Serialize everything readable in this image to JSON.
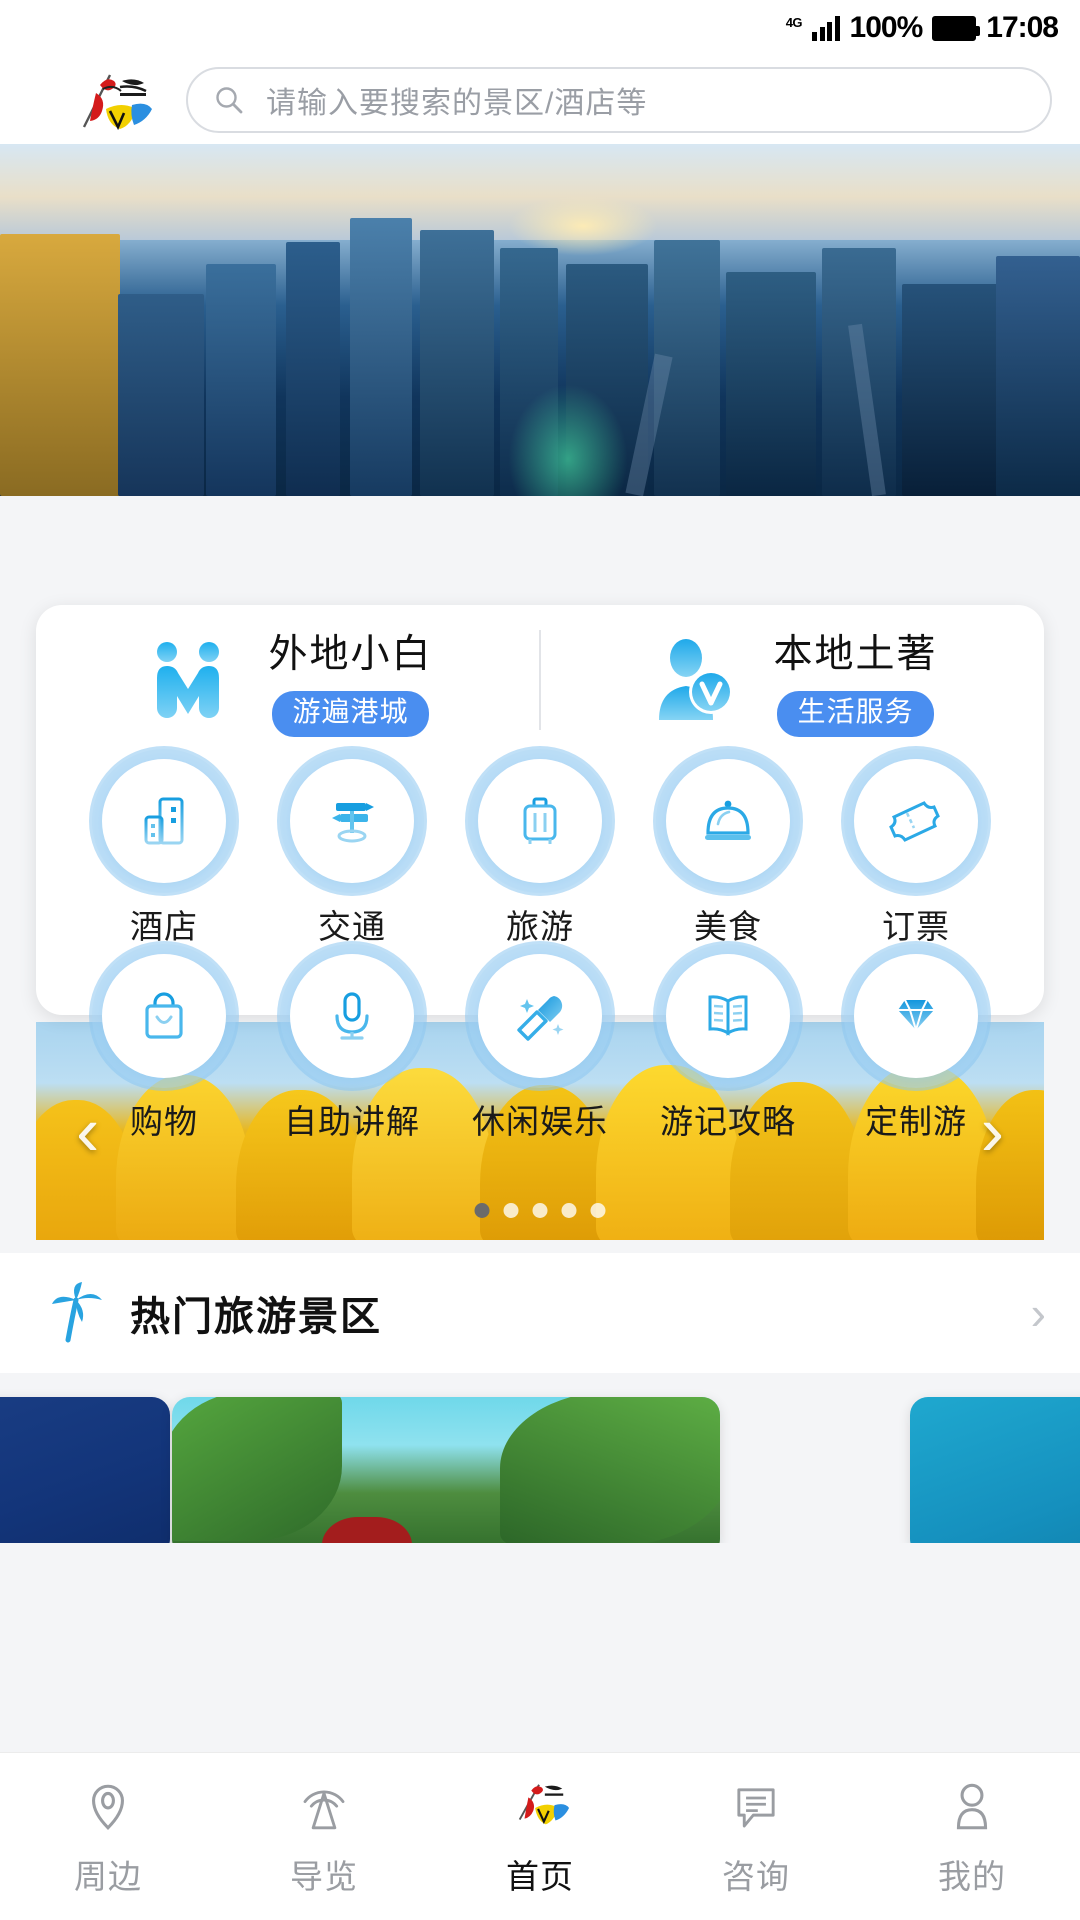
{
  "status_bar": {
    "network": "4G",
    "battery_percent": "100%",
    "time": "17:08"
  },
  "header": {
    "logo_name": "app-logo",
    "search": {
      "placeholder": "请输入要搜索的景区/酒店等",
      "value": "",
      "icon": "search-icon"
    }
  },
  "hero": {
    "alt": "aerial-city-view-banner"
  },
  "user_types": [
    {
      "id": "visitor",
      "icon": "two-people-icon",
      "title": "外地小白",
      "badge": "游遍港城"
    },
    {
      "id": "local",
      "icon": "person-vip-icon",
      "title": "本地土著",
      "badge": "生活服务"
    }
  ],
  "quick_grid": [
    {
      "icon": "hotel-building-icon",
      "label": "酒店"
    },
    {
      "icon": "signpost-icon",
      "label": "交通"
    },
    {
      "icon": "suitcase-icon",
      "label": "旅游"
    },
    {
      "icon": "food-cloche-icon",
      "label": "美食"
    },
    {
      "icon": "ticket-icon",
      "label": "订票"
    },
    {
      "icon": "shopping-bag-icon",
      "label": "购物"
    },
    {
      "icon": "microphone-icon",
      "label": "自助讲解"
    },
    {
      "icon": "karaoke-mic-icon",
      "label": "休闲娱乐"
    },
    {
      "icon": "open-book-icon",
      "label": "游记攻略"
    },
    {
      "icon": "diamond-icon",
      "label": "定制游"
    }
  ],
  "banner": {
    "alt": "yellow-tulips-banner",
    "prev_label": "‹",
    "next_label": "›",
    "dots_total": 5,
    "dots_active_index": 0
  },
  "section": {
    "icon": "palm-tree-icon",
    "title": "热门旅游景区",
    "more_label": "›"
  },
  "scenic_cards": [
    {
      "id": "card-left",
      "alt": "scenic-card-left"
    },
    {
      "id": "card-mid",
      "alt": "scenic-card-willow-trees"
    },
    {
      "id": "card-right",
      "alt": "scenic-card-right"
    }
  ],
  "tabbar": {
    "active_index": 2,
    "items": [
      {
        "icon": "location-pin-icon",
        "label": "周边"
      },
      {
        "icon": "radar-beacon-icon",
        "label": "导览"
      },
      {
        "icon": "home-logo-icon",
        "label": "首页"
      },
      {
        "icon": "chat-bubble-icon",
        "label": "咨询"
      },
      {
        "icon": "person-icon",
        "label": "我的"
      }
    ]
  },
  "colors": {
    "accent_blue": "#29a3e0",
    "badge_blue": "#4a8ef0",
    "text_dark": "#111111",
    "text_muted": "#9a9da2"
  }
}
